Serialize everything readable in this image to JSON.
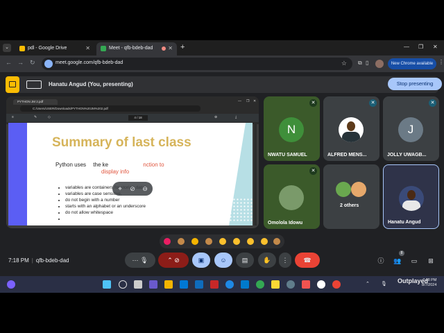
{
  "browser": {
    "tabs": [
      {
        "label": "pdl - Google Drive"
      },
      {
        "label": "Meet - qfb-bdeb-dad"
      }
    ],
    "url": "meet.google.com/qfb-bdeb-dad",
    "update_label": "New Chrome available"
  },
  "banner": {
    "presenter": "Hanatu Angud (You, presenting)",
    "stop_label": "Stop presenting"
  },
  "presentation": {
    "viewer_tab": "PYTHON JM 2.pdf",
    "viewer_path": "C:/Users/USER/Downloads/PYTHON%20JM%202.pdf",
    "page_indicator": "4 / 18",
    "slide_title": "Summary of last class",
    "line1_prefix": "Python uses",
    "line1_mid": "the ke",
    "line1_red": "nction to",
    "line2_red": "display info",
    "bullets": [
      "variables are containers for storing data",
      "variables are case sensitive,",
      "do not begin with  a number",
      "starts with an alphabet or an underscore",
      "do not allow whitespace",
      ""
    ]
  },
  "participants": [
    {
      "name": "NWATU SAMUEL",
      "initial": "N",
      "bg": "#3b5a2a",
      "avatar": "#3f8f3a"
    },
    {
      "name": "ALFRED MENS...",
      "bg": "#3c4043"
    },
    {
      "name": "JOLLY UWAGB...",
      "initial": "J",
      "bg": "#3c4043",
      "avatar": "#6b7a86"
    },
    {
      "name": "Omolola Idowu",
      "bg": "#3b5a2a"
    },
    {
      "name": "2 others",
      "bg": "#3c4043"
    },
    {
      "name": "Hanatu Angud",
      "bg": "#2f3349"
    }
  ],
  "meeting": {
    "time": "7:18 PM",
    "code": "qfb-bdeb-dad",
    "participant_count": "8"
  },
  "taskbar": {
    "time": "7:18 PM",
    "date": "8/7/2024",
    "watermark": "Outplayed",
    "notification_count": "2"
  },
  "colors": {
    "stop_button": "#a8c7fa",
    "end_call": "#ea4335",
    "slide_title": "#d6b45a",
    "slide_accent": "#5b5ef4"
  }
}
